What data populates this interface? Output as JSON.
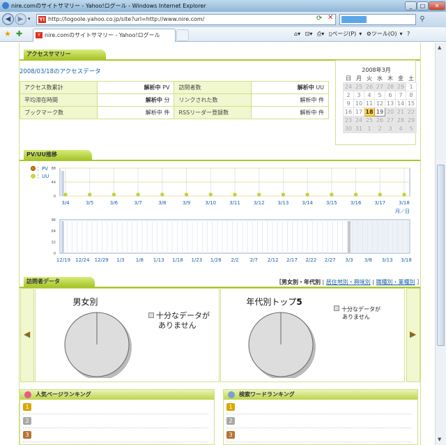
{
  "window": {
    "title": "nire.comのサイトサマリー - Yahoo!ログール - Windows Internet Explorer",
    "url": "http://logoole.yahoo.co.jp/site?url=http://www.nire.com/",
    "tab_label": "nire.comのサイトサマリー - Yahoo!ログール",
    "min": "_",
    "max": "□",
    "close": "✕"
  },
  "toolbar": {
    "page": "ページ(P)",
    "tools": "ツール(O)"
  },
  "summary": {
    "heading": "アクセスサマリー",
    "date_title": "2008/03/18のアクセスデータ",
    "rows": [
      {
        "l1": "アクセス数累計",
        "v1b": "解析中",
        "v1u": "PV",
        "l2": "訪問者数",
        "v2b": "解析中",
        "v2u": "UU"
      },
      {
        "l1": "平均滞在時間",
        "v1b": "解析中",
        "v1u": "分",
        "l2": "リンクされた数",
        "v2b": "解析中",
        "v2u": "件"
      },
      {
        "l1": "ブックマーク数",
        "v1b": "解析中",
        "v1u": "件",
        "l2": "RSSリーダー登録数",
        "v2b": "解析中",
        "v2u": "件"
      }
    ]
  },
  "calendar": {
    "month": "2008年3月",
    "weekdays": [
      "日",
      "月",
      "火",
      "水",
      "木",
      "金",
      "土"
    ],
    "weeks": [
      [
        "24",
        "25",
        "26",
        "27",
        "28",
        "29",
        "1"
      ],
      [
        "2",
        "3",
        "4",
        "5",
        "6",
        "7",
        "8"
      ],
      [
        "9",
        "10",
        "11",
        "12",
        "13",
        "14",
        "15"
      ],
      [
        "16",
        "17",
        "18",
        "19",
        "20",
        "21",
        "22"
      ],
      [
        "23",
        "24",
        "25",
        "26",
        "27",
        "28",
        "29"
      ],
      [
        "30",
        "31",
        "1",
        "2",
        "3",
        "4",
        "5"
      ]
    ],
    "today": "18"
  },
  "pvuu": {
    "heading": "PV/UU推移",
    "legend_pv": "：PV",
    "legend_uu": "：UU",
    "pv_color": "#e07a00",
    "uu_color": "#b8d630",
    "unit": "月／日"
  },
  "chart_data": [
    {
      "type": "line",
      "x": [
        "3/4",
        "3/5",
        "3/6",
        "3/7",
        "3/8",
        "3/9",
        "3/10",
        "3/11",
        "3/12",
        "3/13",
        "3/14",
        "3/15",
        "3/16",
        "3/17",
        "3/18"
      ],
      "series": [
        {
          "name": "PV",
          "values": [
            0,
            0,
            0,
            0,
            0,
            0,
            0,
            0,
            0,
            0,
            0,
            0,
            0,
            0,
            0
          ]
        },
        {
          "name": "UU",
          "values": [
            0,
            0,
            0,
            0,
            0,
            0,
            0,
            0,
            0,
            0,
            0,
            0,
            0,
            0,
            0
          ]
        }
      ],
      "yticks": [
        "88",
        "44",
        "0"
      ],
      "ylim": [
        0,
        88
      ]
    },
    {
      "type": "area",
      "x": [
        "12/19",
        "12/24",
        "12/29",
        "1/3",
        "1/8",
        "1/13",
        "1/18",
        "1/23",
        "1/28",
        "2/2",
        "2/7",
        "2/12",
        "2/17",
        "2/22",
        "2/27",
        "3/3",
        "3/8",
        "3/13",
        "3/18"
      ],
      "yticks": [
        "96",
        "64",
        "32",
        "0"
      ],
      "ylim": [
        0,
        96
      ]
    }
  ],
  "visitors": {
    "heading": "訪問者データ",
    "link_gender_age": "［男女別・年代別",
    "link_region": "居住地別・興味別",
    "link_job": "職種別・業種別",
    "panel1_title": "男女別",
    "panel2_title_a": "年代別トップ",
    "panel2_title_b": "5",
    "note": "十分なデータがありません",
    "note_l1": "十分なデータが",
    "note_l2": "ありません"
  },
  "ranking": {
    "popular": "人気ページランキング",
    "keyword": "検索ワードランキング",
    "ranks": [
      "1",
      "2",
      "3"
    ]
  }
}
